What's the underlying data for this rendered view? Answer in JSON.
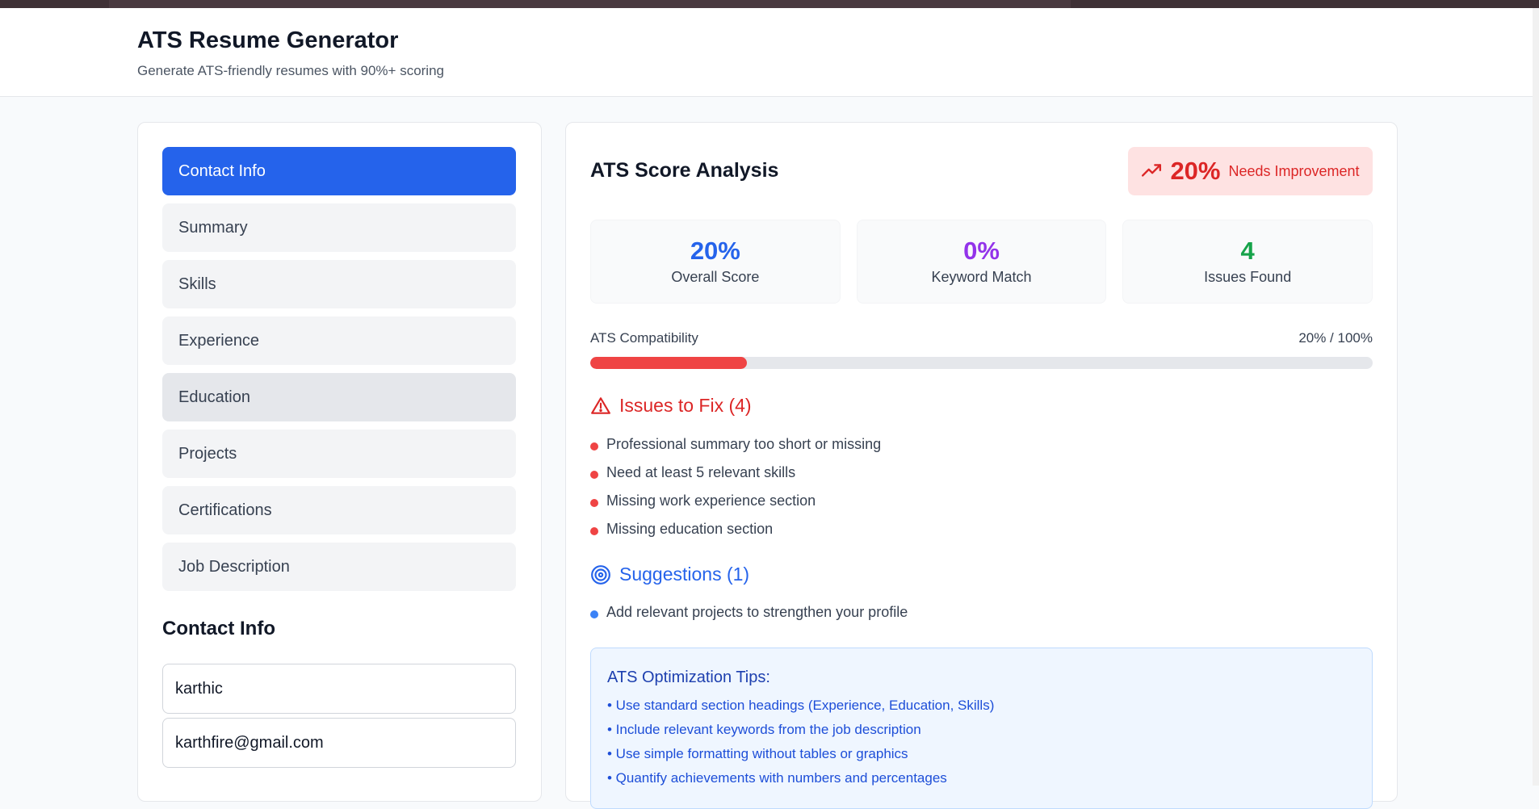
{
  "header": {
    "title": "ATS Resume Generator",
    "subtitle": "Generate ATS-friendly resumes with 90%+ scoring"
  },
  "sidebar": {
    "items": [
      {
        "label": "Contact Info",
        "state": "active"
      },
      {
        "label": "Summary",
        "state": "default"
      },
      {
        "label": "Skills",
        "state": "default"
      },
      {
        "label": "Experience",
        "state": "default"
      },
      {
        "label": "Education",
        "state": "hover"
      },
      {
        "label": "Projects",
        "state": "default"
      },
      {
        "label": "Certifications",
        "state": "default"
      },
      {
        "label": "Job Description",
        "state": "default"
      }
    ],
    "section_title": "Contact Info",
    "fields": {
      "name_value": "karthic",
      "email_value": "karthfire@gmail.com"
    }
  },
  "analysis": {
    "title": "ATS Score Analysis",
    "badge": {
      "score": "20%",
      "label": "Needs Improvement"
    },
    "stats": [
      {
        "value": "20%",
        "caption": "Overall Score",
        "color": "#2563eb"
      },
      {
        "value": "0%",
        "caption": "Keyword Match",
        "color": "#9333ea"
      },
      {
        "value": "4",
        "caption": "Issues Found",
        "color": "#16a34a"
      }
    ],
    "compatibility": {
      "label": "ATS Compatibility",
      "value_text": "20% / 100%",
      "percent": 20
    },
    "issues": {
      "title": "Issues to Fix (4)",
      "items": [
        "Professional summary too short or missing",
        "Need at least 5 relevant skills",
        "Missing work experience section",
        "Missing education section"
      ]
    },
    "suggestions": {
      "title": "Suggestions (1)",
      "items": [
        "Add relevant projects to strengthen your profile"
      ]
    },
    "tips": {
      "title": "ATS Optimization Tips:",
      "items": [
        "• Use standard section headings (Experience, Education, Skills)",
        "• Include relevant keywords from the job description",
        "• Use simple formatting without tables or graphics",
        "• Quantify achievements with numbers and percentages"
      ]
    }
  },
  "colors": {
    "primary": "#2563eb",
    "danger": "#dc2626",
    "badge_bg": "#fee2e2",
    "tips_bg": "#eff6ff"
  },
  "icons": {
    "badge": "trending-up-icon",
    "issues": "alert-triangle-icon",
    "suggestions": "target-icon"
  }
}
